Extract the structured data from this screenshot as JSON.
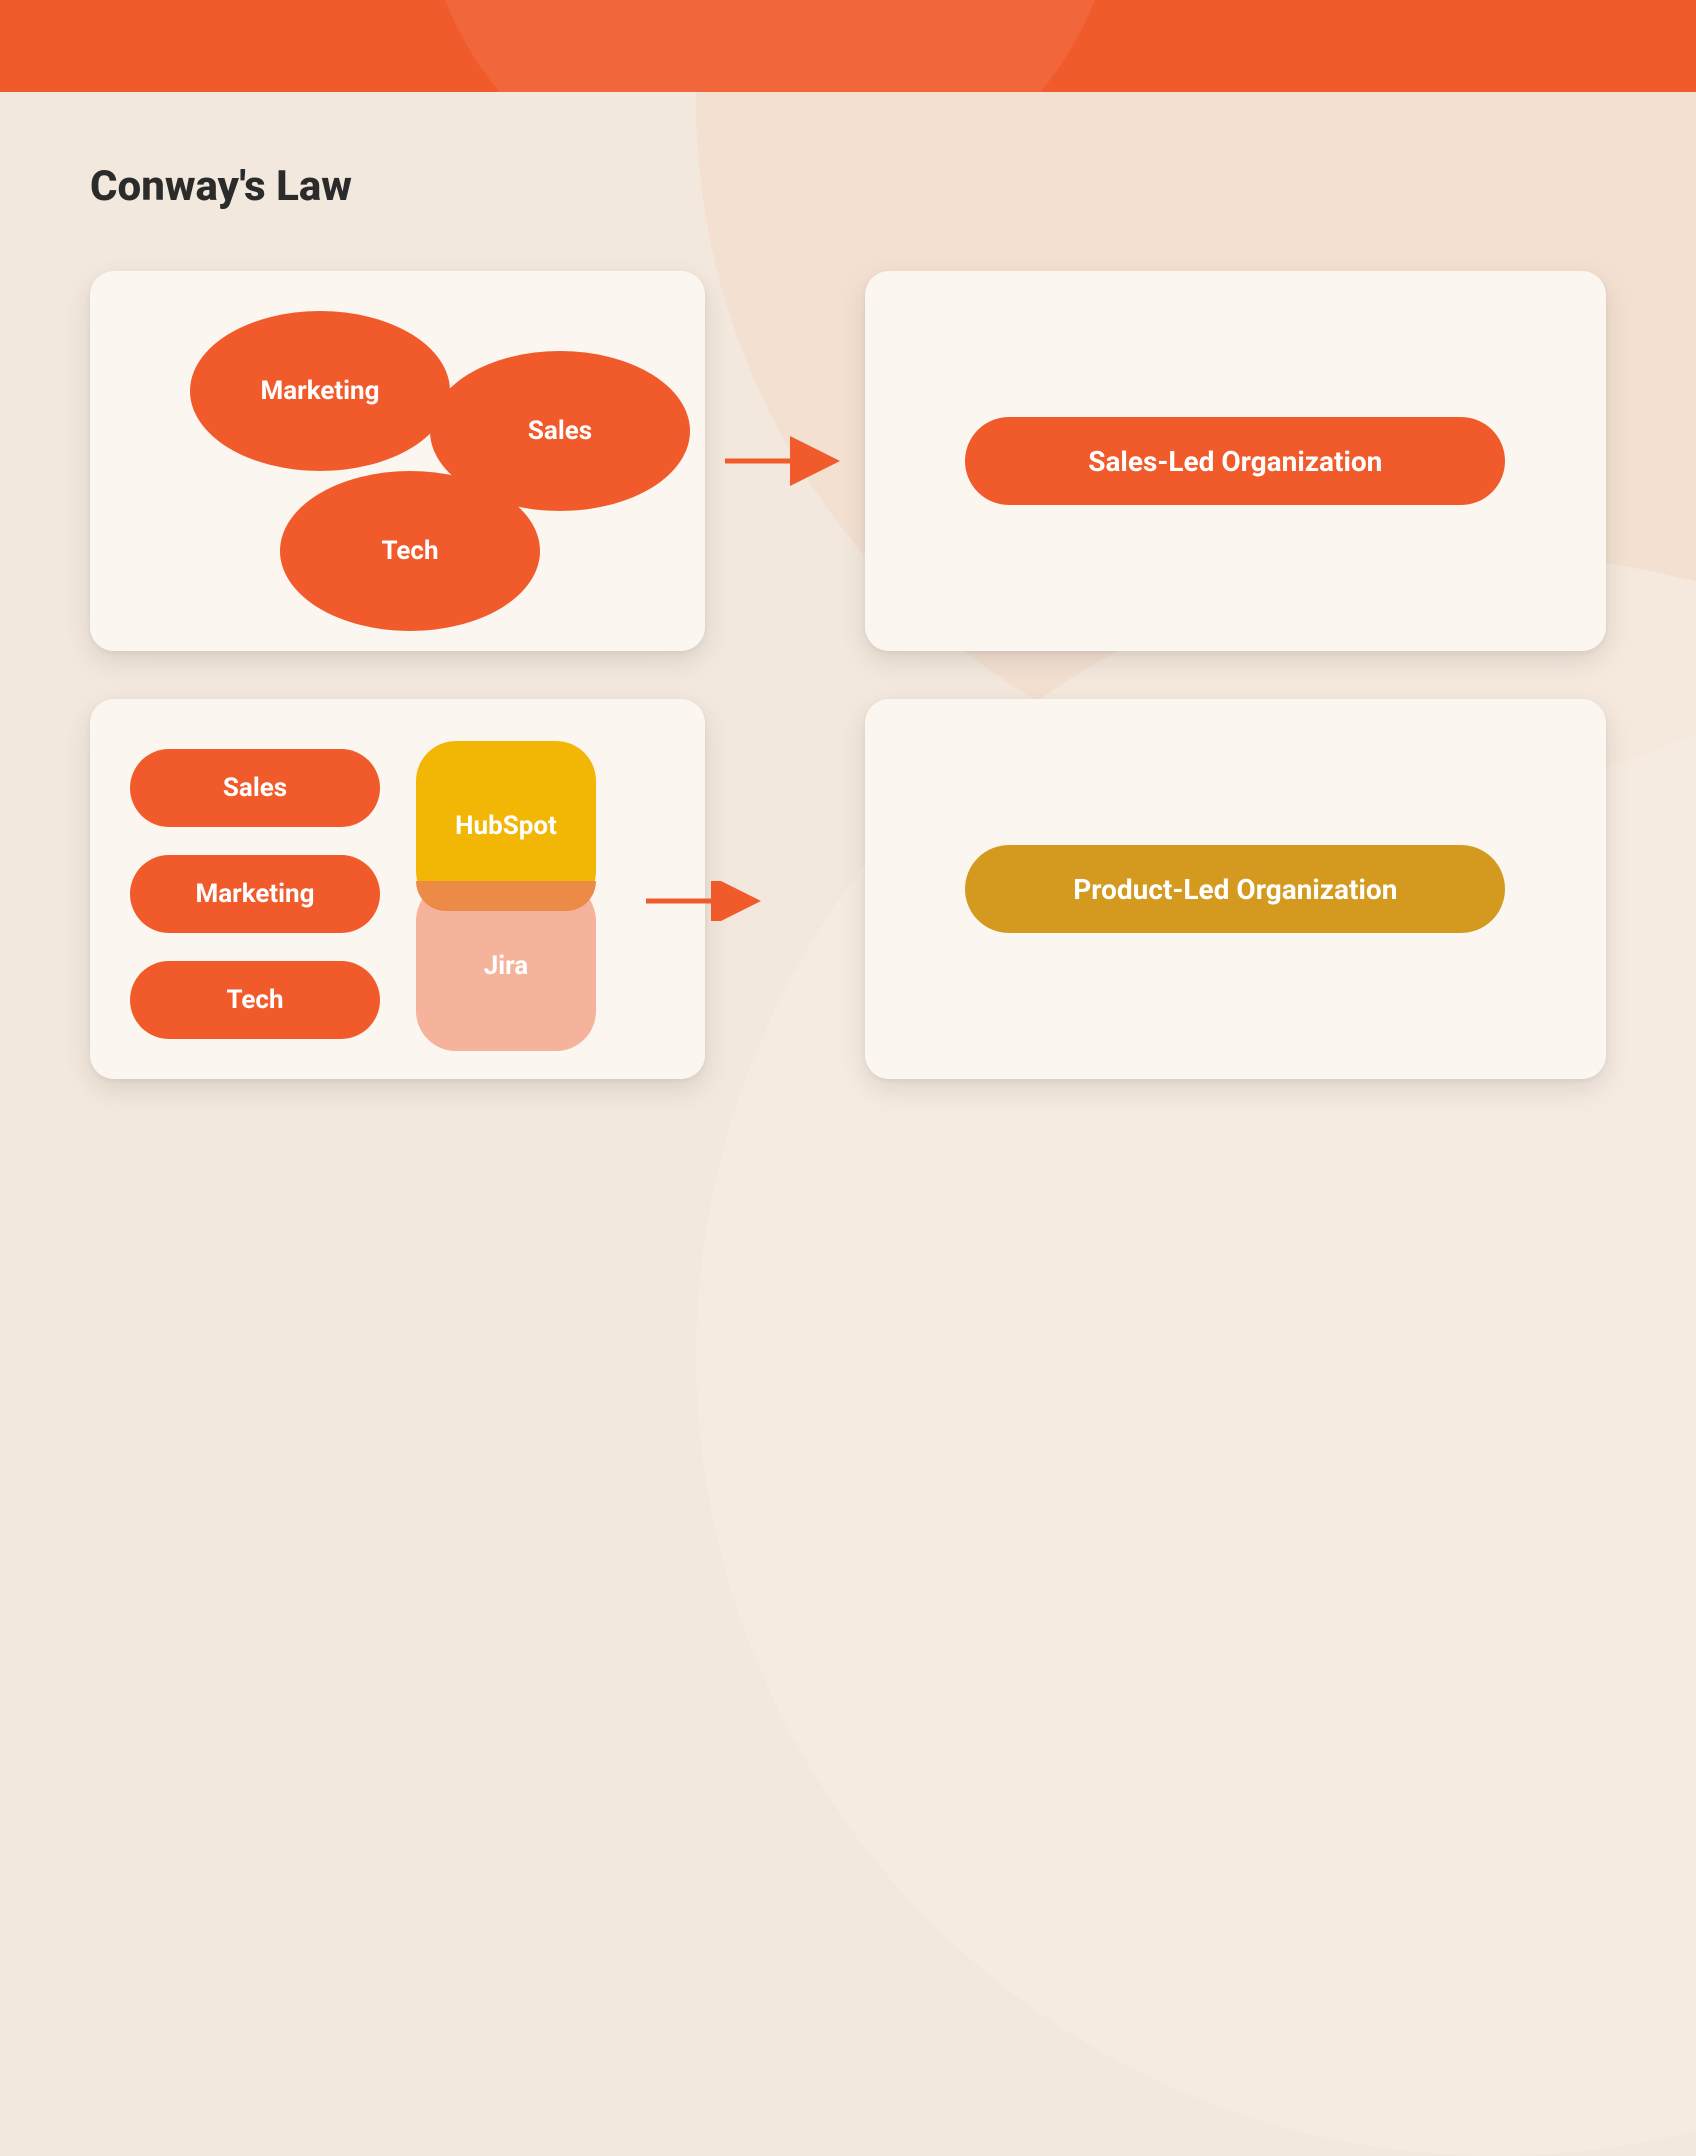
{
  "colors": {
    "accent_orange": "#f15a2b",
    "accent_gold": "#d49a1f",
    "accent_yellow": "#f2b705",
    "accent_peach": "#f6b39b",
    "card_bg": "#fbf6ef",
    "page_bg": "#f2e8dd",
    "text_dark": "#2b2b2b"
  },
  "title": "Conway's Law",
  "row1": {
    "ellipses": {
      "marketing": "Marketing",
      "sales": "Sales",
      "tech": "Tech"
    },
    "result": "Sales-Led Organization"
  },
  "row2": {
    "departments": [
      "Sales",
      "Marketing",
      "Tech"
    ],
    "tools": {
      "hubspot": "HubSpot",
      "jira": "Jira"
    },
    "result": "Product-Led Organization"
  }
}
